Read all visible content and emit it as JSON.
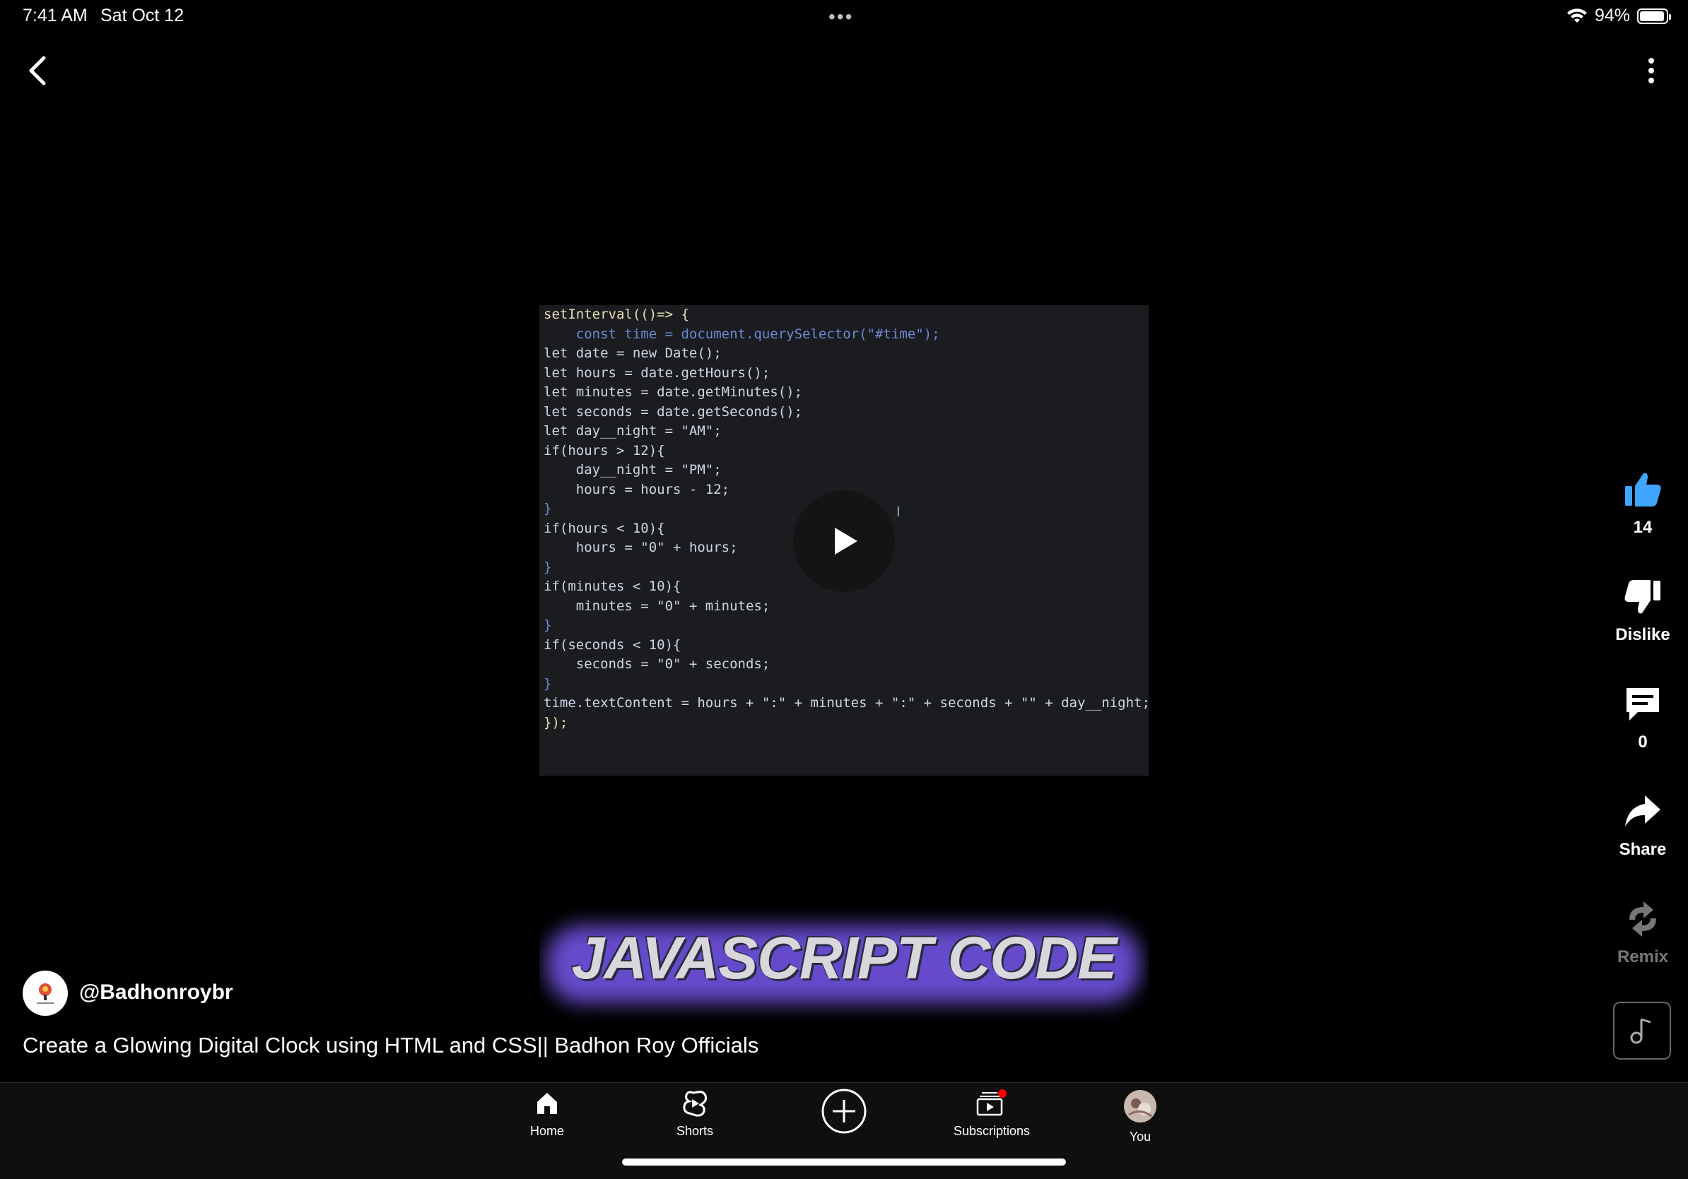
{
  "status_bar": {
    "time": "7:41 AM",
    "date": "Sat Oct 12",
    "dots": "•••",
    "battery": "94%",
    "battery_level": 0.94
  },
  "header": {
    "back_icon": "chevron-left-icon",
    "more_icon": "vertical-dots-icon"
  },
  "video": {
    "code_lines": [
      "setInterval(()=> {",
      "    const time = document.querySelector(\"#time\");",
      "let date = new Date();",
      "let hours = date.getHours();",
      "let minutes = date.getMinutes();",
      "let seconds = date.getSeconds();",
      "let day__night = \"AM\";",
      "if(hours > 12){",
      "    day__night = \"PM\";",
      "    hours = hours - 12;",
      "}",
      "if(hours < 10){",
      "    hours = \"0\" + hours;",
      "}",
      "if(minutes < 10){",
      "    minutes = \"0\" + minutes;",
      "}",
      "if(seconds < 10){",
      "    seconds = \"0\" + seconds;",
      "}",
      "time.textContent = hours + \":\" + minutes + \":\" + seconds + \"\" + day__night;",
      "});"
    ],
    "cursor_glyph": "I",
    "overlay_text": "JAVASCRIPT CODE"
  },
  "channel": {
    "handle": "@Badhonroybr",
    "title": "Create a Glowing Digital Clock using HTML and CSS|| Badhon Roy Officials"
  },
  "actions": {
    "like_count": "14",
    "dislike_label": "Dislike",
    "comment_count": "0",
    "share_label": "Share",
    "remix_label": "Remix"
  },
  "nav": {
    "home": "Home",
    "shorts": "Shorts",
    "subscriptions": "Subscriptions",
    "you": "You"
  },
  "colors": {
    "like_blue": "#3ea6ff",
    "notification_red": "#ff0000",
    "glow_purple": "#6b4fd6"
  }
}
